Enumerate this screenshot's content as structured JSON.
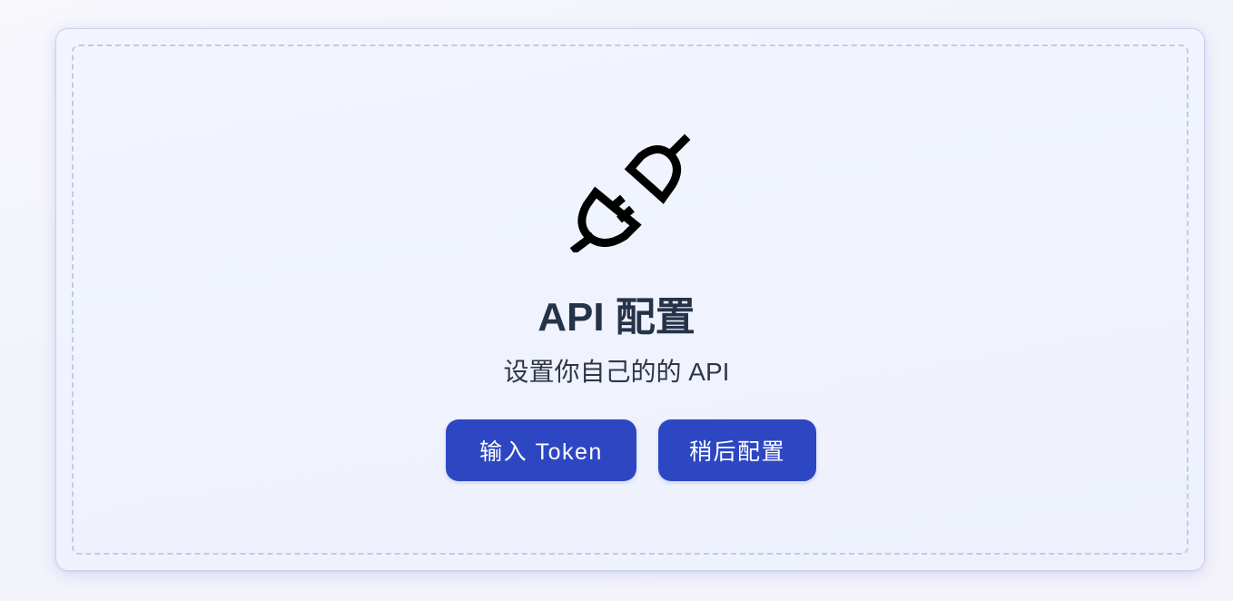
{
  "card": {
    "icon": "plug-icon",
    "title": "API 配置",
    "subtitle": "设置你自己的的 API",
    "buttons": {
      "enter_token_label": "输入 Token",
      "configure_later_label": "稍后配置"
    }
  },
  "colors": {
    "primary_button": "#2d47c3",
    "title_text": "#253349",
    "card_border": "#cdd0ee",
    "dashed_border": "#c5c9e6"
  }
}
